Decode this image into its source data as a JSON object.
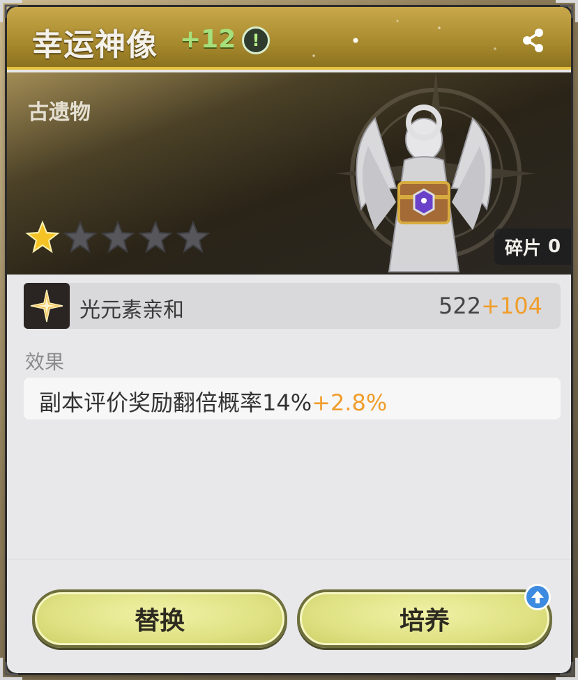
{
  "header": {
    "title": "幸运神像",
    "level": "+12",
    "info_glyph": "!",
    "share_icon": "share-icon"
  },
  "hero": {
    "category": "古遗物",
    "stars": {
      "filled": 1,
      "total": 5
    },
    "fragments_label": "碎片",
    "fragments_count": "0"
  },
  "stat": {
    "icon": "light-element-icon",
    "name": "光元素亲和",
    "value": "522",
    "bonus": "+104"
  },
  "effect": {
    "title": "效果",
    "text": "副本评价奖励翻倍概率14%",
    "bonus": "+2.8%"
  },
  "buttons": {
    "replace_label": "替换",
    "train_label": "培养"
  },
  "colors": {
    "accent_gold": "#e3c23d",
    "bonus_orange": "#f09d2a",
    "level_green": "#a6e07c",
    "button_fill": "#dfe183",
    "upgrade_blue": "#3c8be0"
  }
}
